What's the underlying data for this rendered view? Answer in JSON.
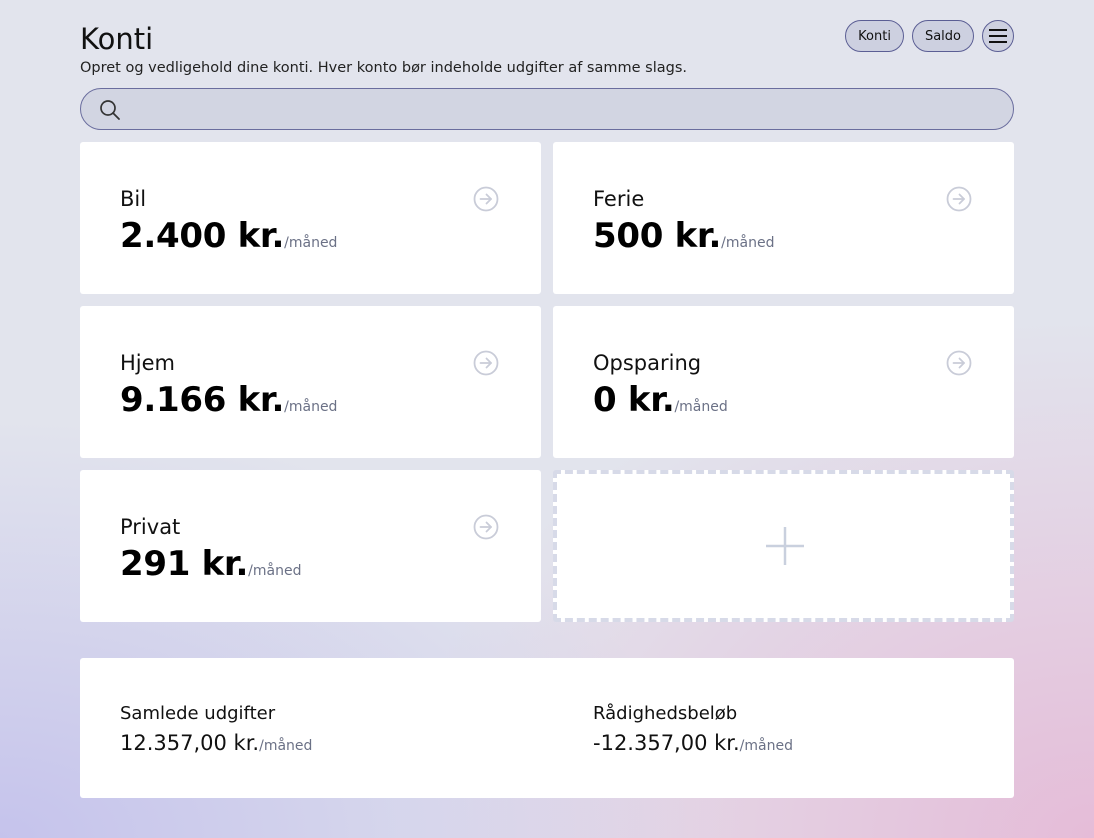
{
  "header": {
    "title": "Konti",
    "subtitle": "Opret og vedligehold dine konti. Hver konto bør indeholde udgifter af samme slags.",
    "nav": {
      "konti": "Konti",
      "saldo": "Saldo"
    }
  },
  "search": {
    "placeholder": "",
    "value": ""
  },
  "accounts": [
    {
      "name": "Bil",
      "amount": "2.400 kr.",
      "per": "/måned"
    },
    {
      "name": "Ferie",
      "amount": "500 kr.",
      "per": "/måned"
    },
    {
      "name": "Hjem",
      "amount": "9.166 kr.",
      "per": "/måned"
    },
    {
      "name": "Opsparing",
      "amount": "0 kr.",
      "per": "/måned"
    },
    {
      "name": "Privat",
      "amount": "291 kr.",
      "per": "/måned"
    }
  ],
  "summary": {
    "total_label": "Samlede udgifter",
    "total_value": "12.357,00 kr.",
    "total_per": "/måned",
    "available_label": "Rådighedsbeløb",
    "available_value": "-12.357,00 kr.",
    "available_per": "/måned"
  },
  "colors": {
    "accent": "#5b5e94",
    "pill_bg": "#cdd0e0",
    "muted": "#6b7186"
  }
}
